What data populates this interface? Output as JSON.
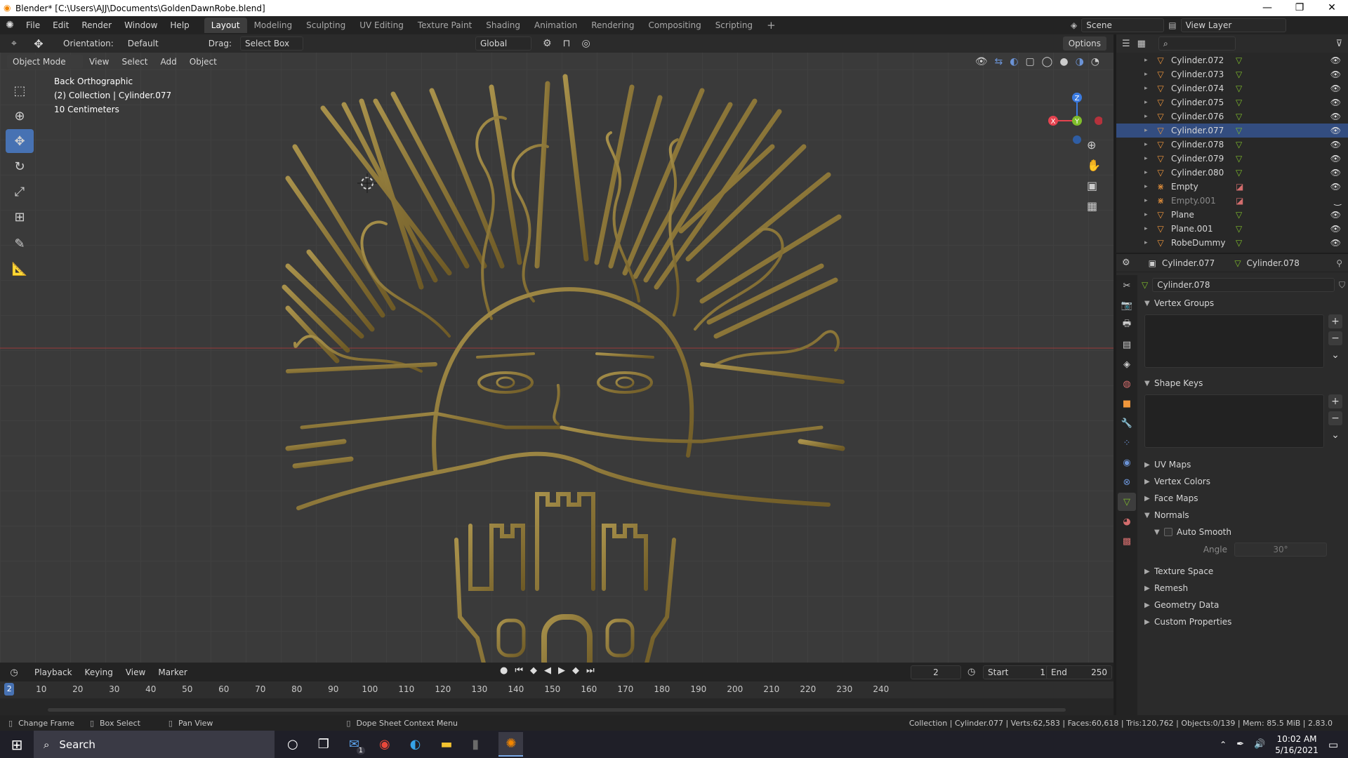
{
  "window": {
    "title": "Blender* [C:\\Users\\AJJ\\Documents\\GoldenDawnRobe.blend]",
    "minimize": "—",
    "maximize": "❐",
    "close": "✕"
  },
  "menu": [
    "File",
    "Edit",
    "Render",
    "Window",
    "Help"
  ],
  "workspaces": [
    "Layout",
    "Modeling",
    "Sculpting",
    "UV Editing",
    "Texture Paint",
    "Shading",
    "Animation",
    "Rendering",
    "Compositing",
    "Scripting"
  ],
  "workspace_add": "+",
  "scene": {
    "label": "Scene",
    "view_layer": "View Layer"
  },
  "tool_header": {
    "orientation_label": "Orientation:",
    "orientation_value": "Default",
    "drag_label": "Drag:",
    "drag_value": "Select Box",
    "transform_orientation": "Global",
    "options": "Options"
  },
  "viewport_header": {
    "mode": "Object Mode",
    "menus": [
      "View",
      "Select",
      "Add",
      "Object"
    ]
  },
  "viewport_info": {
    "view": "Back Orthographic",
    "collection": "(2) Collection | Cylinder.077",
    "scale": "10 Centimeters"
  },
  "gizmo": {
    "z": "Z",
    "y": "Y",
    "x": "X"
  },
  "outliner": {
    "search_placeholder": "",
    "rows": [
      {
        "name": "Cylinder.072",
        "type": "mesh",
        "selected": false
      },
      {
        "name": "Cylinder.073",
        "type": "mesh",
        "selected": false
      },
      {
        "name": "Cylinder.074",
        "type": "mesh",
        "selected": false
      },
      {
        "name": "Cylinder.075",
        "type": "mesh",
        "selected": false
      },
      {
        "name": "Cylinder.076",
        "type": "mesh",
        "selected": false
      },
      {
        "name": "Cylinder.077",
        "type": "mesh",
        "selected": true
      },
      {
        "name": "Cylinder.078",
        "type": "mesh",
        "selected": false
      },
      {
        "name": "Cylinder.079",
        "type": "mesh",
        "selected": false
      },
      {
        "name": "Cylinder.080",
        "type": "mesh",
        "selected": false
      },
      {
        "name": "Empty",
        "type": "empty",
        "selected": false
      },
      {
        "name": "Empty.001",
        "type": "empty",
        "selected": false,
        "dim": true
      },
      {
        "name": "Plane",
        "type": "mesh",
        "selected": false
      },
      {
        "name": "Plane.001",
        "type": "mesh",
        "selected": false
      },
      {
        "name": "RobeDummy",
        "type": "mesh",
        "selected": false
      }
    ]
  },
  "properties": {
    "breadcrumb_object": "Cylinder.077",
    "breadcrumb_data": "Cylinder.078",
    "data_name": "Cylinder.078",
    "panels": {
      "vertex_groups": "Vertex Groups",
      "shape_keys": "Shape Keys",
      "uv_maps": "UV Maps",
      "vertex_colors": "Vertex Colors",
      "face_maps": "Face Maps",
      "normals": "Normals",
      "auto_smooth": "Auto Smooth",
      "angle_label": "Angle",
      "angle_value": "30°",
      "texture_space": "Texture Space",
      "remesh": "Remesh",
      "geometry_data": "Geometry Data",
      "custom_properties": "Custom Properties"
    }
  },
  "timeline": {
    "menus": [
      "Playback",
      "Keying",
      "View",
      "Marker"
    ],
    "current_frame": "2",
    "start_label": "Start",
    "start": "1",
    "end_label": "End",
    "end": "250",
    "ticks": [
      "10",
      "20",
      "30",
      "40",
      "50",
      "60",
      "70",
      "80",
      "90",
      "100",
      "110",
      "120",
      "130",
      "140",
      "150",
      "160",
      "170",
      "180",
      "190",
      "200",
      "210",
      "220",
      "230",
      "240"
    ],
    "playhead": "2"
  },
  "statusbar": {
    "hint1": "Change Frame",
    "hint2": "Box Select",
    "hint3": "Pan View",
    "hint4": "Dope Sheet Context Menu",
    "stats": "Collection | Cylinder.077 | Verts:62,583 | Faces:60,618 | Tris:120,762 | Objects:0/139 | Mem: 85.5 MiB | 2.83.0"
  },
  "taskbar": {
    "search": "Search",
    "time": "10:02 AM",
    "date": "5/16/2021",
    "mail_badge": "1"
  },
  "colors": {
    "accent": "#4772b3",
    "gold": "#8a7433",
    "axis_x": "#e5434f",
    "axis_y": "#7fbd2b",
    "axis_z": "#3b7be0"
  }
}
